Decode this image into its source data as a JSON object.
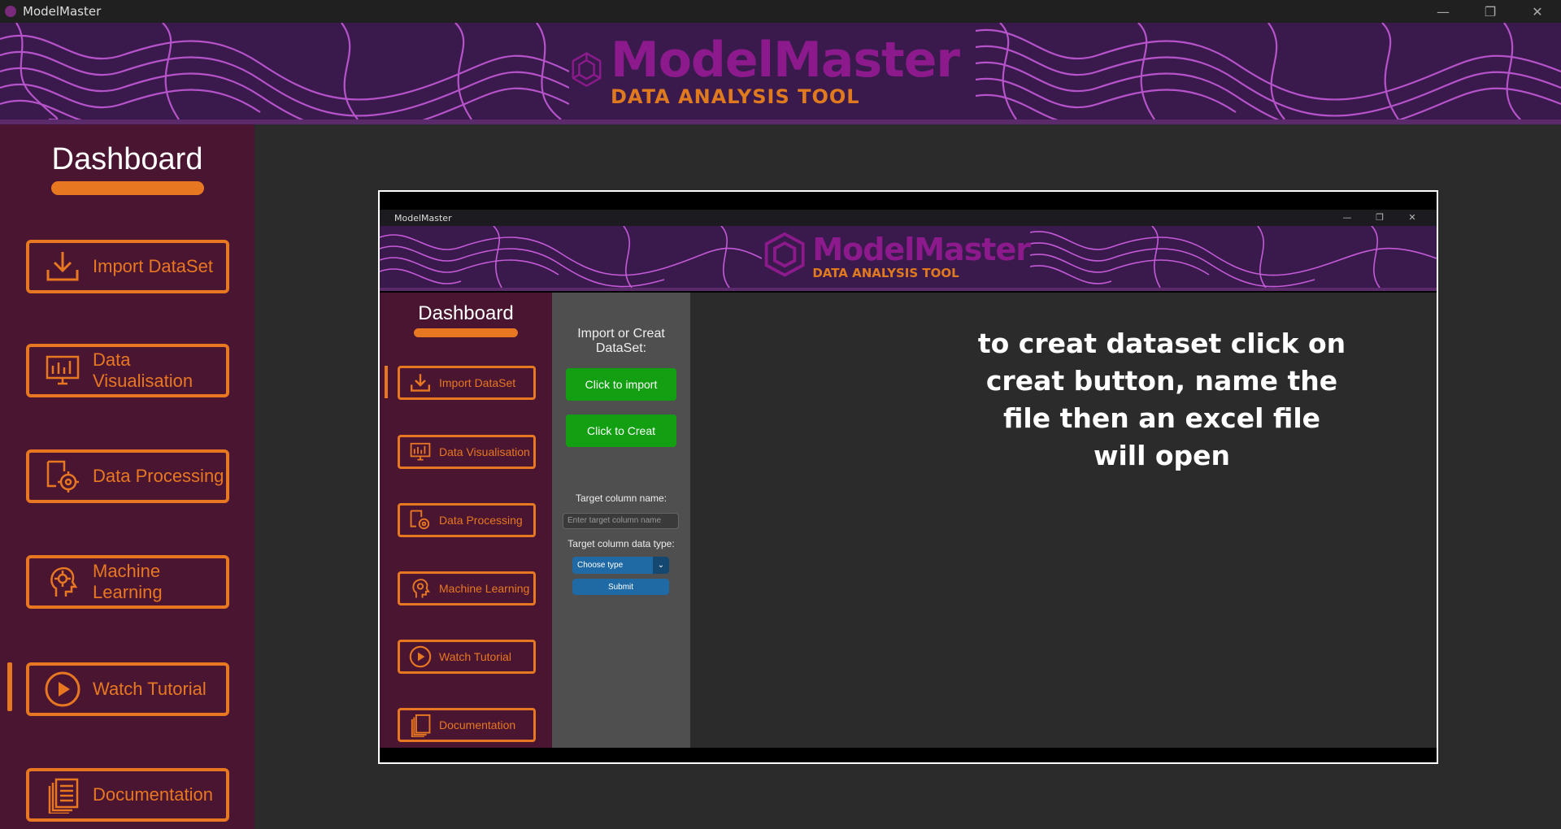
{
  "window": {
    "title": "ModelMaster",
    "controls": [
      "—",
      "❐",
      "✕"
    ]
  },
  "banner": {
    "brand": "ModelMaster",
    "tagline": "DATA ANALYSIS TOOL"
  },
  "sidebar": {
    "title": "Dashboard",
    "active_index": 4,
    "items": [
      {
        "label": "Import DataSet",
        "icon": "download-icon"
      },
      {
        "label": "Data Visualisation",
        "icon": "chart-monitor-icon"
      },
      {
        "label": "Data Processing",
        "icon": "gear-document-icon"
      },
      {
        "label": "Machine Learning",
        "icon": "ai-head-icon"
      },
      {
        "label": "Watch Tutorial",
        "icon": "play-icon"
      },
      {
        "label": "Documentation",
        "icon": "documents-icon"
      }
    ]
  },
  "embedded": {
    "window_title": "ModelMaster",
    "controls": [
      "—",
      "❐",
      "✕"
    ],
    "brand": "ModelMaster",
    "tagline": "DATA ANALYSIS TOOL",
    "sidebar": {
      "title": "Dashboard",
      "active_index": 0,
      "items": [
        {
          "label": "Import DataSet"
        },
        {
          "label": "Data Visualisation"
        },
        {
          "label": "Data Processing"
        },
        {
          "label": "Machine Learning"
        },
        {
          "label": "Watch Tutorial"
        },
        {
          "label": "Documentation"
        }
      ]
    },
    "panel": {
      "heading": "Import or Creat DataSet:",
      "import_button": "Click to import",
      "create_button": "Click to Creat",
      "target_label": "Target column name:",
      "target_placeholder": "Enter target column name",
      "type_label": "Target column data type:",
      "type_select": "Choose type",
      "submit": "Submit"
    },
    "instruction": "to creat dataset click on creat button, name the file then an excel file will open"
  },
  "colors": {
    "accent": "#e87722",
    "sidebar_bg": "#4a1530",
    "banner_bg": "#3a1a4c",
    "brand": "#8c1a8c",
    "green": "#12a012",
    "blue": "#1f6aa5"
  }
}
